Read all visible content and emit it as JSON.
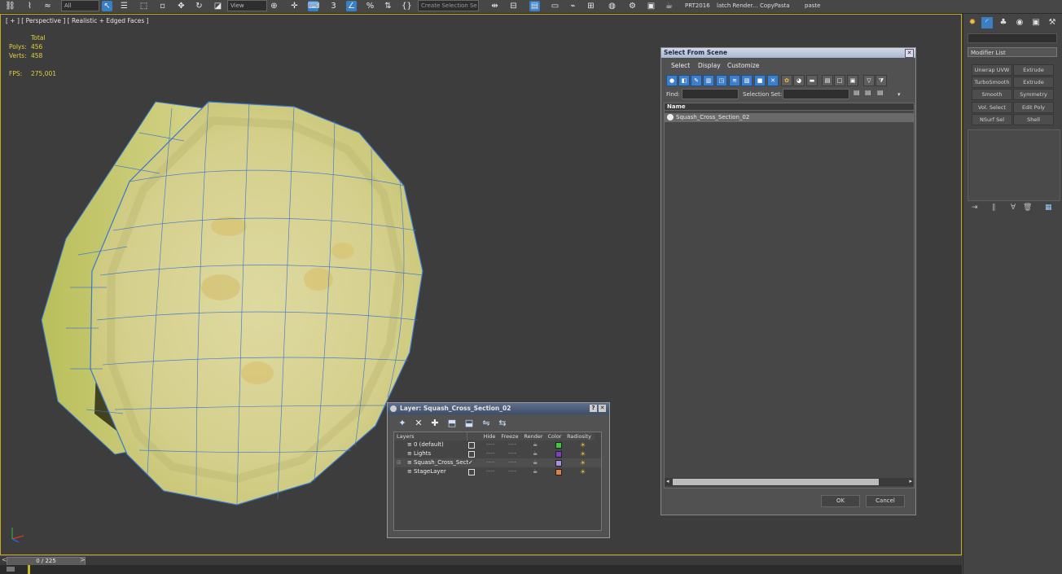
{
  "toolbar": {
    "filter_value": "All",
    "ref_coord_value": "View",
    "create_selection_set_placeholder": "Create Selection Se",
    "scripts": [
      "PRT2016",
      "latch Render...",
      "CopyPasta",
      "paste"
    ]
  },
  "viewport": {
    "label": "[ + ] [ Perspective ] [ Realistic + Edged Faces ]",
    "stats": {
      "total_label": "Total",
      "polys_label": "Polys:",
      "polys_value": "456",
      "verts_label": "Verts:",
      "verts_value": "458",
      "fps_label": "FPS:",
      "fps_value": "275,001"
    }
  },
  "timeline": {
    "frame": "0 / 225",
    "prev": "<",
    "next": ">"
  },
  "command_panel": {
    "modifier_list_label": "Modifier List",
    "modifier_buttons": [
      "Unwrap UVW",
      "Extrude",
      "TurboSmooth",
      "Extrude",
      "Smooth",
      "Symmetry",
      "Vol. Select",
      "Edit Poly",
      "NSurf Sel",
      "Shell"
    ]
  },
  "select_from_scene": {
    "title": "Select From Scene",
    "menus": [
      "Select",
      "Display",
      "Customize"
    ],
    "find_label": "Find:",
    "find_value": "",
    "selection_set_label": "Selection Set:",
    "column_name": "Name",
    "objects": [
      "Squash_Cross_Section_02"
    ],
    "ok_label": "OK",
    "cancel_label": "Cancel"
  },
  "layer_dialog": {
    "title": "Layer: Squash_Cross_Section_02",
    "columns": [
      "Layers",
      "Hide",
      "Freeze",
      "Render",
      "Color",
      "Radiosity"
    ],
    "rows": [
      {
        "name": "0 (default)",
        "color": "#3ec83e"
      },
      {
        "name": "Lights",
        "color": "#7a3ec8"
      },
      {
        "name": "Squash_Cross_Sect",
        "color": "#a890e0"
      },
      {
        "name": "StageLayer",
        "color": "#e0803e"
      }
    ]
  }
}
